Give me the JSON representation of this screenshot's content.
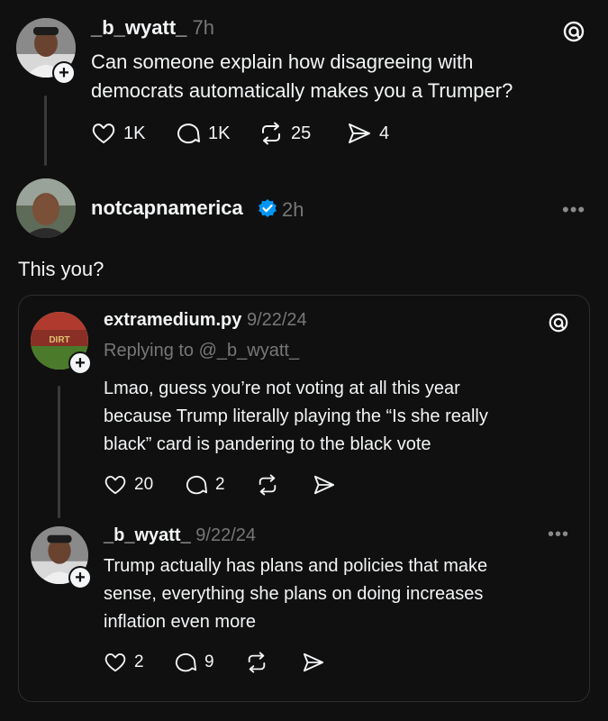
{
  "post": {
    "username": "_b_wyatt_",
    "time": "7h",
    "line1": "Can someone explain how disagreeing with",
    "line2": "democrats automatically makes you a Trumper?",
    "likes": "1K",
    "comments": "1K",
    "reposts": "25",
    "shares": "4"
  },
  "reply": {
    "username": "notcapnamerica",
    "time": "2h",
    "text": "This you?"
  },
  "quote": {
    "first": {
      "username": "extramedium.py",
      "time": "9/22/24",
      "replying_to": "Replying to @_b_wyatt_",
      "line1": "Lmao, guess you’re not voting at all this year",
      "line2": "because Trump literally playing the “Is she really",
      "line3": "black” card is pandering to the black vote",
      "likes": "20",
      "comments": "2",
      "avatar_text": "DIRT"
    },
    "second": {
      "username": "_b_wyatt_",
      "time": "9/22/24",
      "line1": "Trump actually has plans and policies that make",
      "line2": "sense, everything she plans on doing increases",
      "line3": "inflation even more",
      "likes": "2",
      "comments": "9"
    }
  },
  "colors": {
    "background": "#101010",
    "text": "#f3f5f7",
    "muted": "#777777",
    "verified": "#0095f6"
  }
}
